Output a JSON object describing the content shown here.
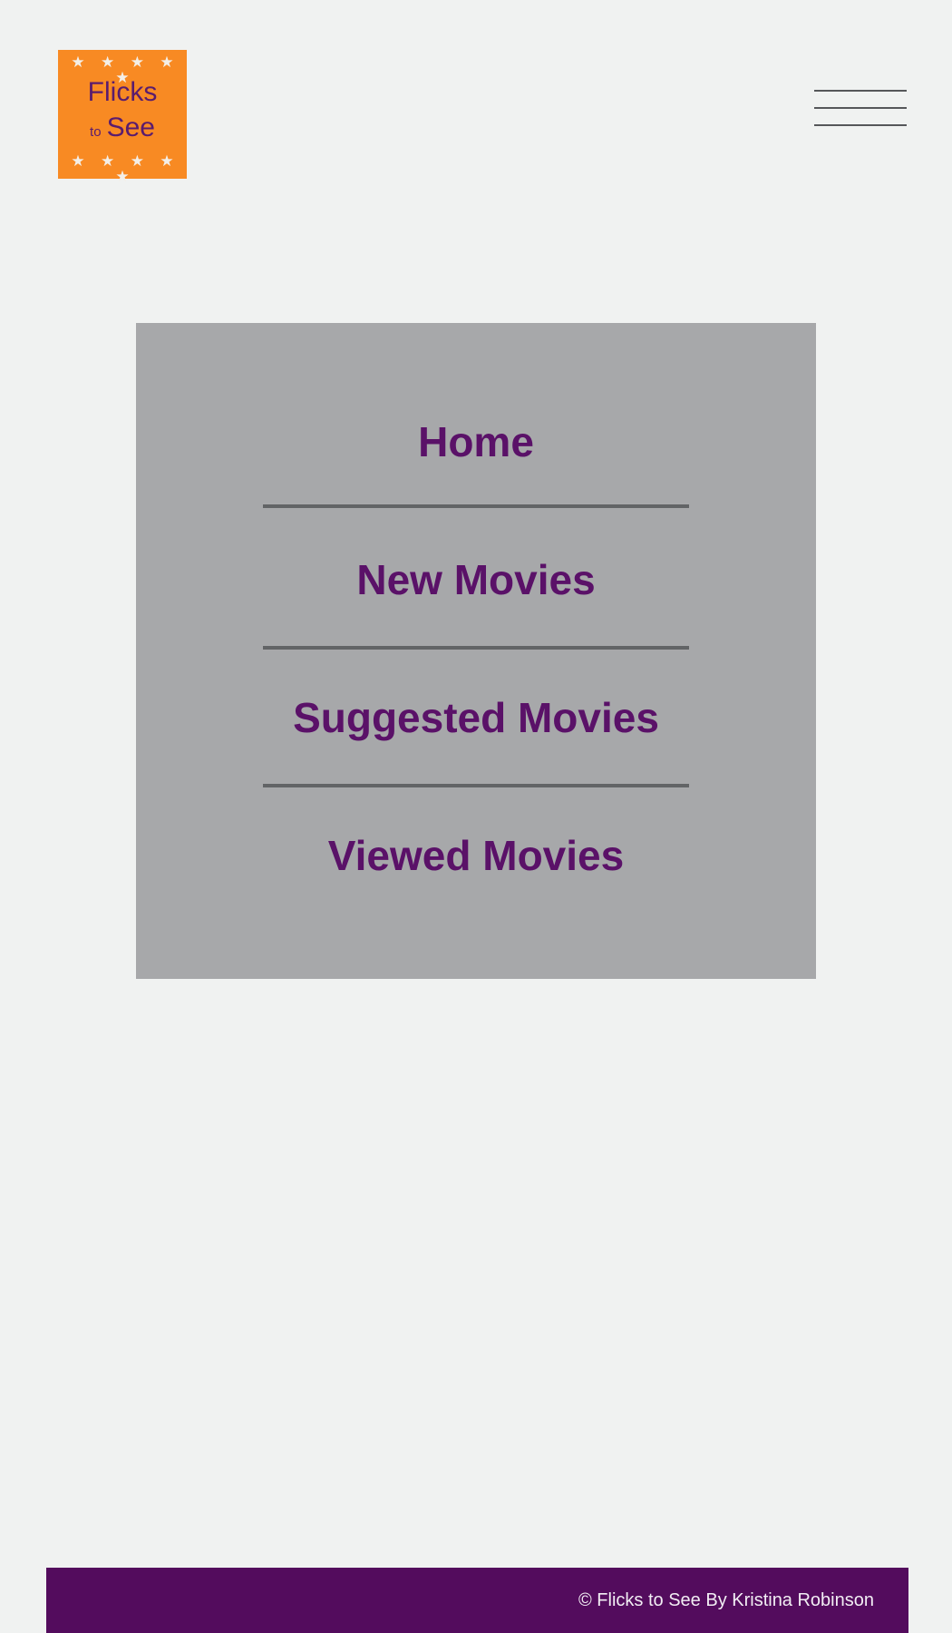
{
  "logo": {
    "line1": "Flicks",
    "line2_small": "to",
    "line2_big": "See",
    "stars_top": "★ ★ ★ ★ ★",
    "stars_bottom": "★ ★ ★ ★ ★",
    "background_color": "#f88a23",
    "text_color": "#5a1c6e"
  },
  "header": {
    "menu_icon": "hamburger-menu-icon"
  },
  "menu": {
    "items": [
      {
        "label": "Home"
      },
      {
        "label": "New Movies"
      },
      {
        "label": "Suggested Movies"
      },
      {
        "label": "Viewed Movies"
      }
    ],
    "panel_color": "#a7a8aa",
    "text_color": "#5a1168"
  },
  "footer": {
    "copyright": "© Flicks to See By Kristina Robinson",
    "background_color": "#530c5d"
  }
}
